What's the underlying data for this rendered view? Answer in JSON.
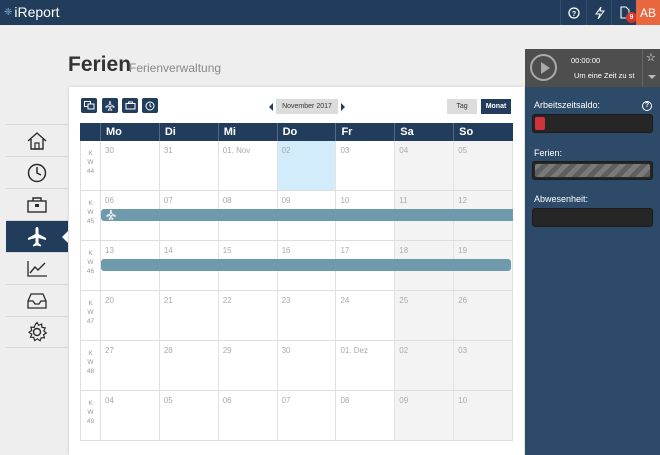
{
  "app": {
    "logo": "iReport",
    "logo_mark": "❈",
    "avatar_initials": "AB",
    "notification_count": "9"
  },
  "page": {
    "title": "Ferien",
    "subtitle": "Ferienverwaltung"
  },
  "nav": {
    "items": [
      {
        "icon": "home-icon"
      },
      {
        "icon": "clock-icon"
      },
      {
        "icon": "briefcase-icon"
      },
      {
        "icon": "airplane-icon",
        "active": true
      },
      {
        "icon": "chart-icon"
      },
      {
        "icon": "inbox-icon"
      },
      {
        "icon": "gear-icon"
      }
    ]
  },
  "toolbar": {
    "month_label": "November 2017",
    "view_day": "Tag",
    "view_month": "Monat"
  },
  "calendar": {
    "weekdays": [
      "Mo",
      "Di",
      "Mi",
      "Do",
      "Fr",
      "Sa",
      "So"
    ],
    "weeks": [
      {
        "kw": "44",
        "days": [
          "30",
          "31",
          "01. Nov",
          "02",
          "03",
          "04",
          "05"
        ]
      },
      {
        "kw": "45",
        "days": [
          "06",
          "07",
          "08",
          "09",
          "10",
          "11",
          "12"
        ]
      },
      {
        "kw": "46",
        "days": [
          "13",
          "14",
          "15",
          "16",
          "17",
          "18",
          "19"
        ]
      },
      {
        "kw": "47",
        "days": [
          "20",
          "21",
          "22",
          "23",
          "24",
          "25",
          "26"
        ]
      },
      {
        "kw": "48",
        "days": [
          "27",
          "28",
          "29",
          "30",
          "01. Dez",
          "02",
          "03"
        ]
      },
      {
        "kw": "49",
        "days": [
          "04",
          "05",
          "06",
          "07",
          "08",
          "09",
          "10"
        ]
      }
    ],
    "today_week": 0,
    "today_day": 3
  },
  "panel": {
    "timer_time": "00:00:00",
    "timer_text": "Um eine Zeit zu st",
    "saldo_label": "Arbeitszeitsaldo:",
    "help": "?",
    "ferien_label": "Ferien:",
    "abwesenheit_label": "Abwesenheit:"
  },
  "colors": {
    "navy": "#213d5b",
    "vacation_bar": "#6f9aab",
    "avatar": "#e8673e",
    "today": "#d3ecfb"
  }
}
